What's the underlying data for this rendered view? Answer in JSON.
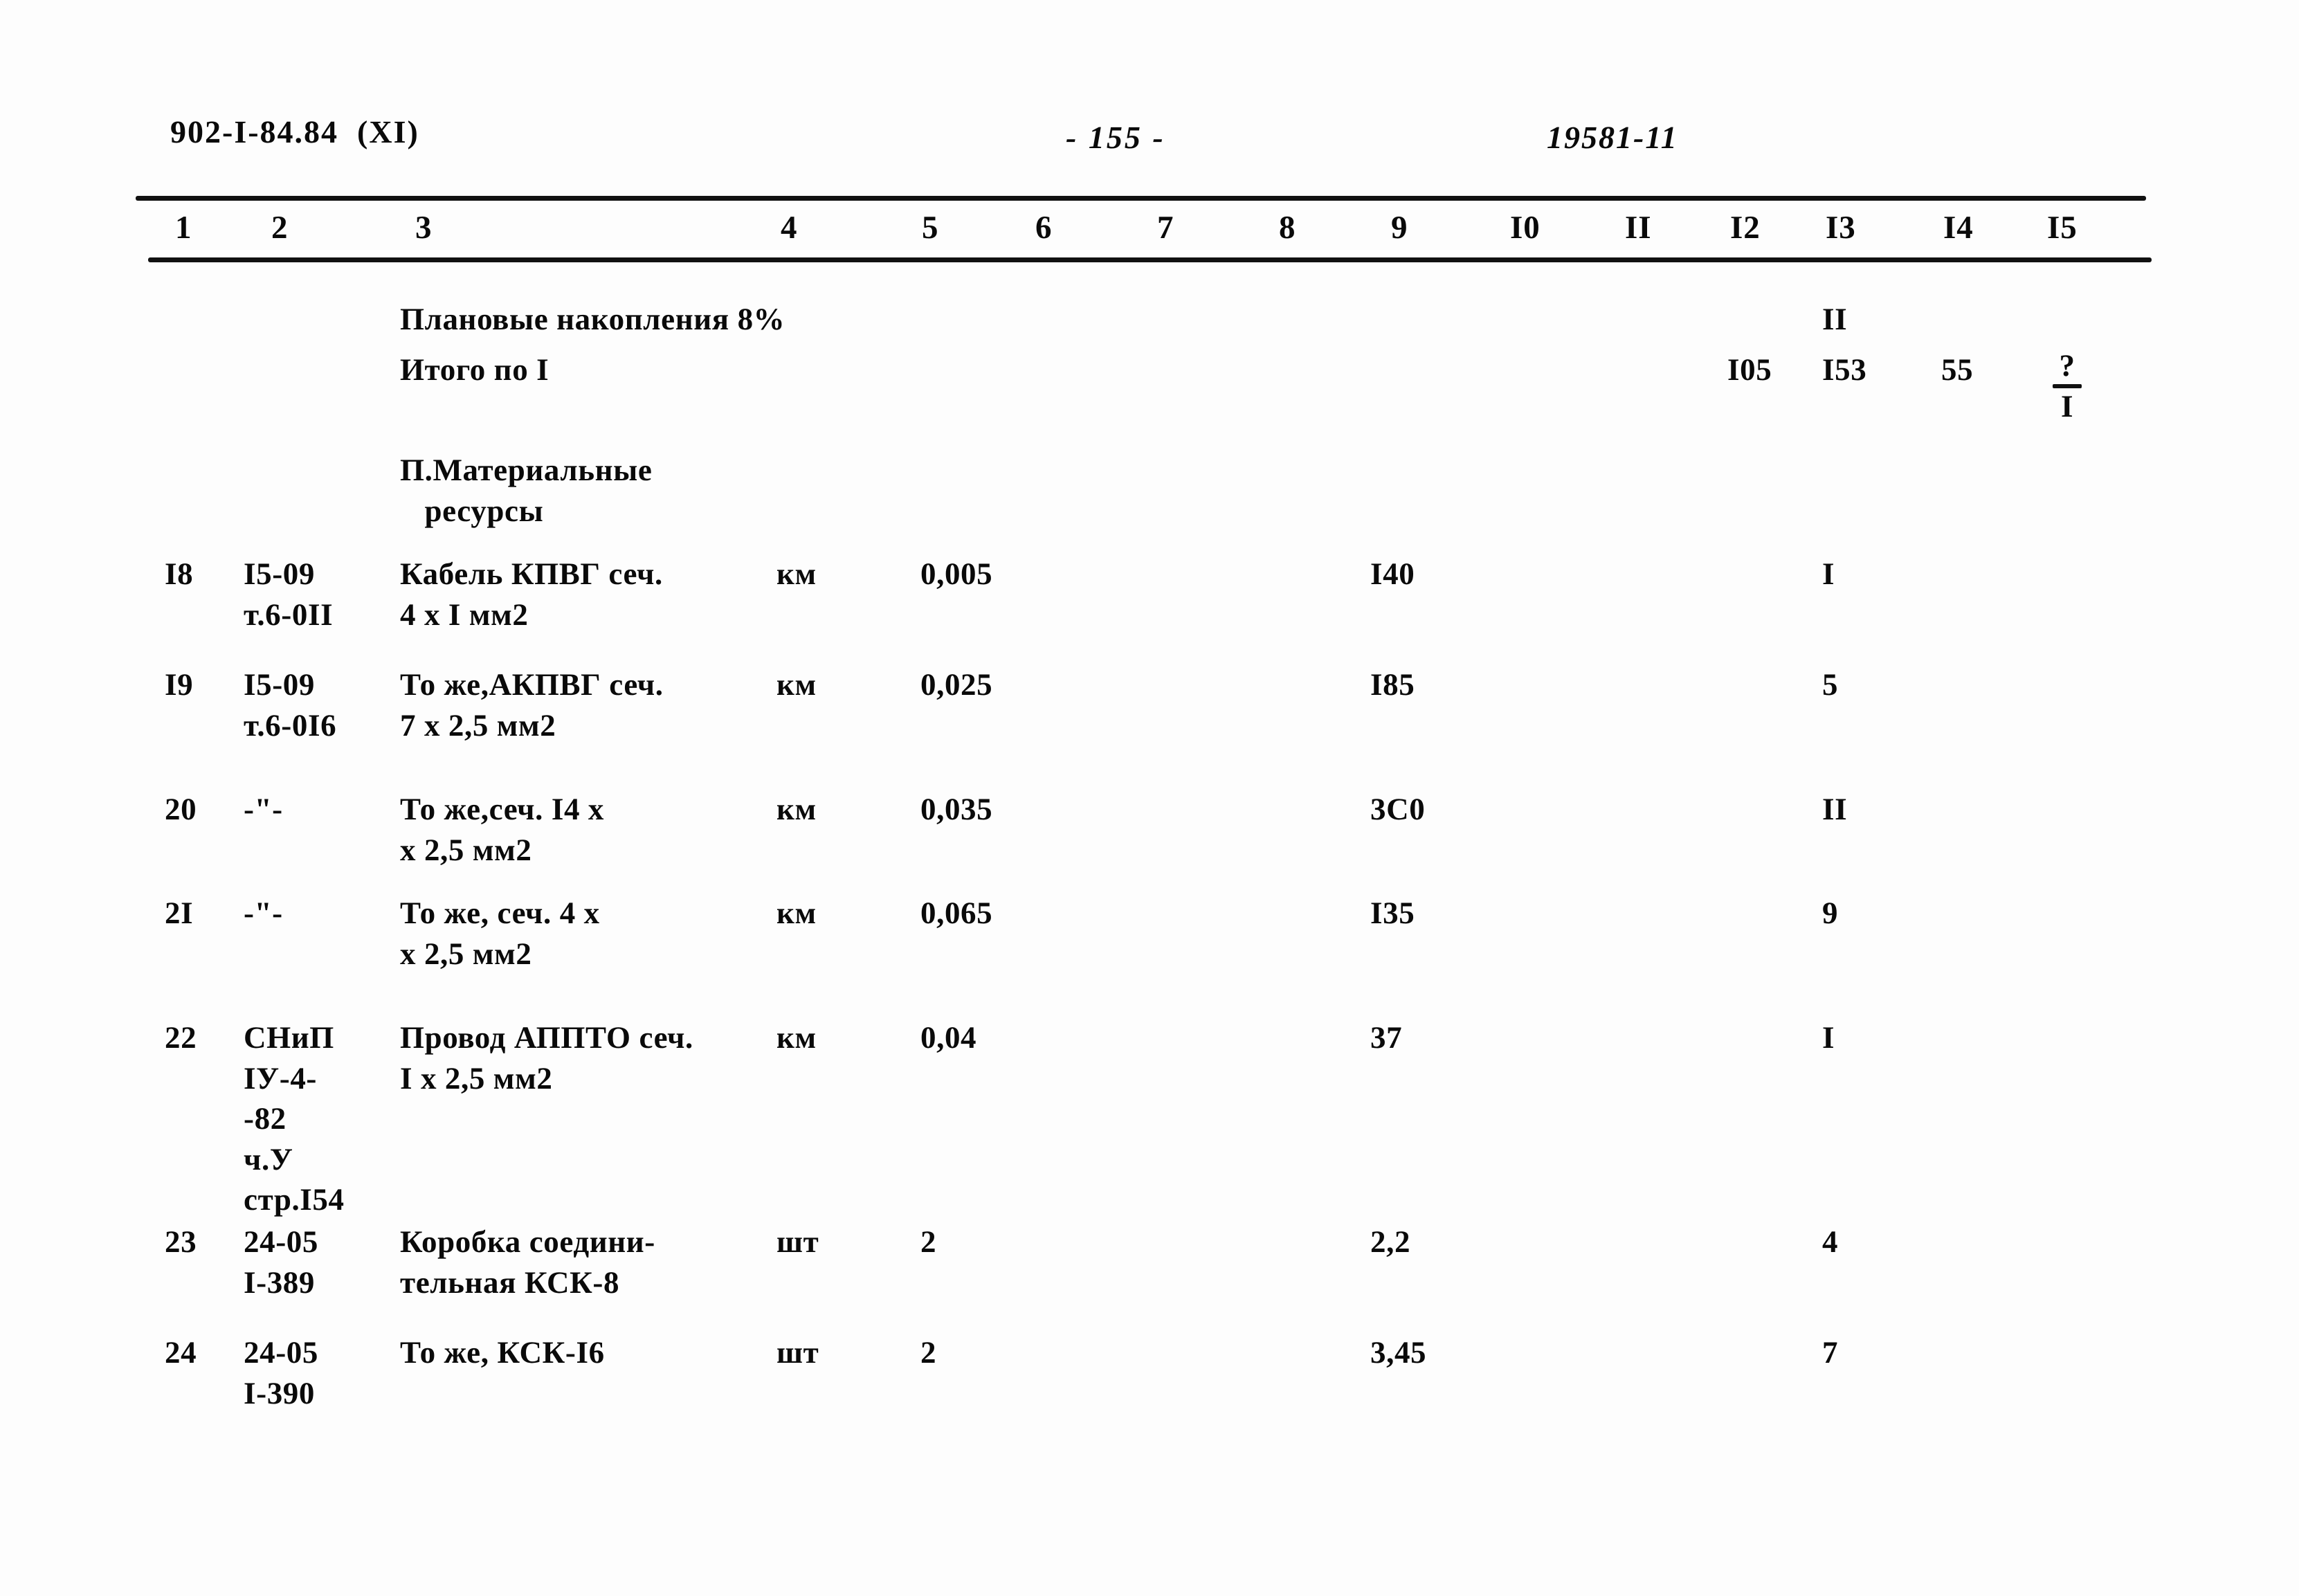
{
  "header": {
    "doc_code": "902-I-84.84  (XI)",
    "page_number": "- 155 -",
    "sheet_code": "19581-11"
  },
  "table": {
    "column_numbers": [
      "1",
      "2",
      "3",
      "4",
      "5",
      "6",
      "7",
      "8",
      "9",
      "I0",
      "II",
      "I2",
      "I3",
      "I4",
      "I5"
    ],
    "rows": [
      {
        "num": "",
        "code": "",
        "name": "Плановые накопления 8%",
        "unit": "",
        "qty": "",
        "price": "",
        "v12": "",
        "v13": "II",
        "v14": "",
        "v15": ""
      },
      {
        "num": "",
        "code": "",
        "name": "Итого по I",
        "unit": "",
        "qty": "",
        "price": "",
        "v12": "I05",
        "v13": "I53",
        "v14": "55",
        "v15_frac_top": "?",
        "v15_frac_bottom": "I"
      },
      {
        "num": "",
        "code": "",
        "name": "П.Материальные\n   ресурсы",
        "unit": "",
        "qty": "",
        "price": "",
        "v12": "",
        "v13": "",
        "v14": "",
        "v15": ""
      },
      {
        "num": "I8",
        "code": "I5-09\nт.6-0II",
        "name": "Кабель КПВГ сеч.\n4 х I мм2",
        "unit": "км",
        "qty": "0,005",
        "price": "I40",
        "v12": "",
        "v13": "I",
        "v14": "",
        "v15": ""
      },
      {
        "num": "I9",
        "code": "I5-09\nт.6-0I6",
        "name": "То же,АКПВГ сеч.\n7 х 2,5 мм2",
        "unit": "км",
        "qty": "0,025",
        "price": "I85",
        "v12": "",
        "v13": "5",
        "v14": "",
        "v15": ""
      },
      {
        "num": "20",
        "code": "-\"-",
        "name": "То же,сеч. I4 х\nх 2,5 мм2",
        "unit": "км",
        "qty": "0,035",
        "price": "3С0",
        "v12": "",
        "v13": "II",
        "v14": "",
        "v15": ""
      },
      {
        "num": "2I",
        "code": "-\"-",
        "name": "То же, сеч. 4 х\nх 2,5 мм2",
        "unit": "км",
        "qty": "0,065",
        "price": "I35",
        "v12": "",
        "v13": "9",
        "v14": "",
        "v15": ""
      },
      {
        "num": "22",
        "code": "СНиП\nIУ-4-\n-82\nч.У\nстр.I54",
        "name": "Провод АППТО сеч.\nI х 2,5 мм2",
        "unit": "км",
        "qty": "0,04",
        "price": "37",
        "v12": "",
        "v13": "I",
        "v14": "",
        "v15": ""
      },
      {
        "num": "23",
        "code": "24-05\nI-389",
        "name": "Коробка соедини-\nтельная КСК-8",
        "unit": "шт",
        "qty": "2",
        "price": "2,2",
        "v12": "",
        "v13": "4",
        "v14": "",
        "v15": ""
      },
      {
        "num": "24",
        "code": "24-05\nI-390",
        "name": "То же, КСК-I6",
        "unit": "шт",
        "qty": "2",
        "price": "3,45",
        "v12": "",
        "v13": "7",
        "v14": "",
        "v15": ""
      }
    ]
  },
  "layout": {
    "column_number_x": [
      253,
      392,
      600,
      1128,
      1332,
      1496,
      1672,
      1848,
      2010,
      2182,
      2348,
      2500,
      2638,
      2808,
      2958
    ],
    "row_top": [
      432,
      505,
      650,
      800,
      960,
      1140,
      1290,
      1470,
      1765,
      1925
    ],
    "ink_color": "#0a0a0a"
  }
}
